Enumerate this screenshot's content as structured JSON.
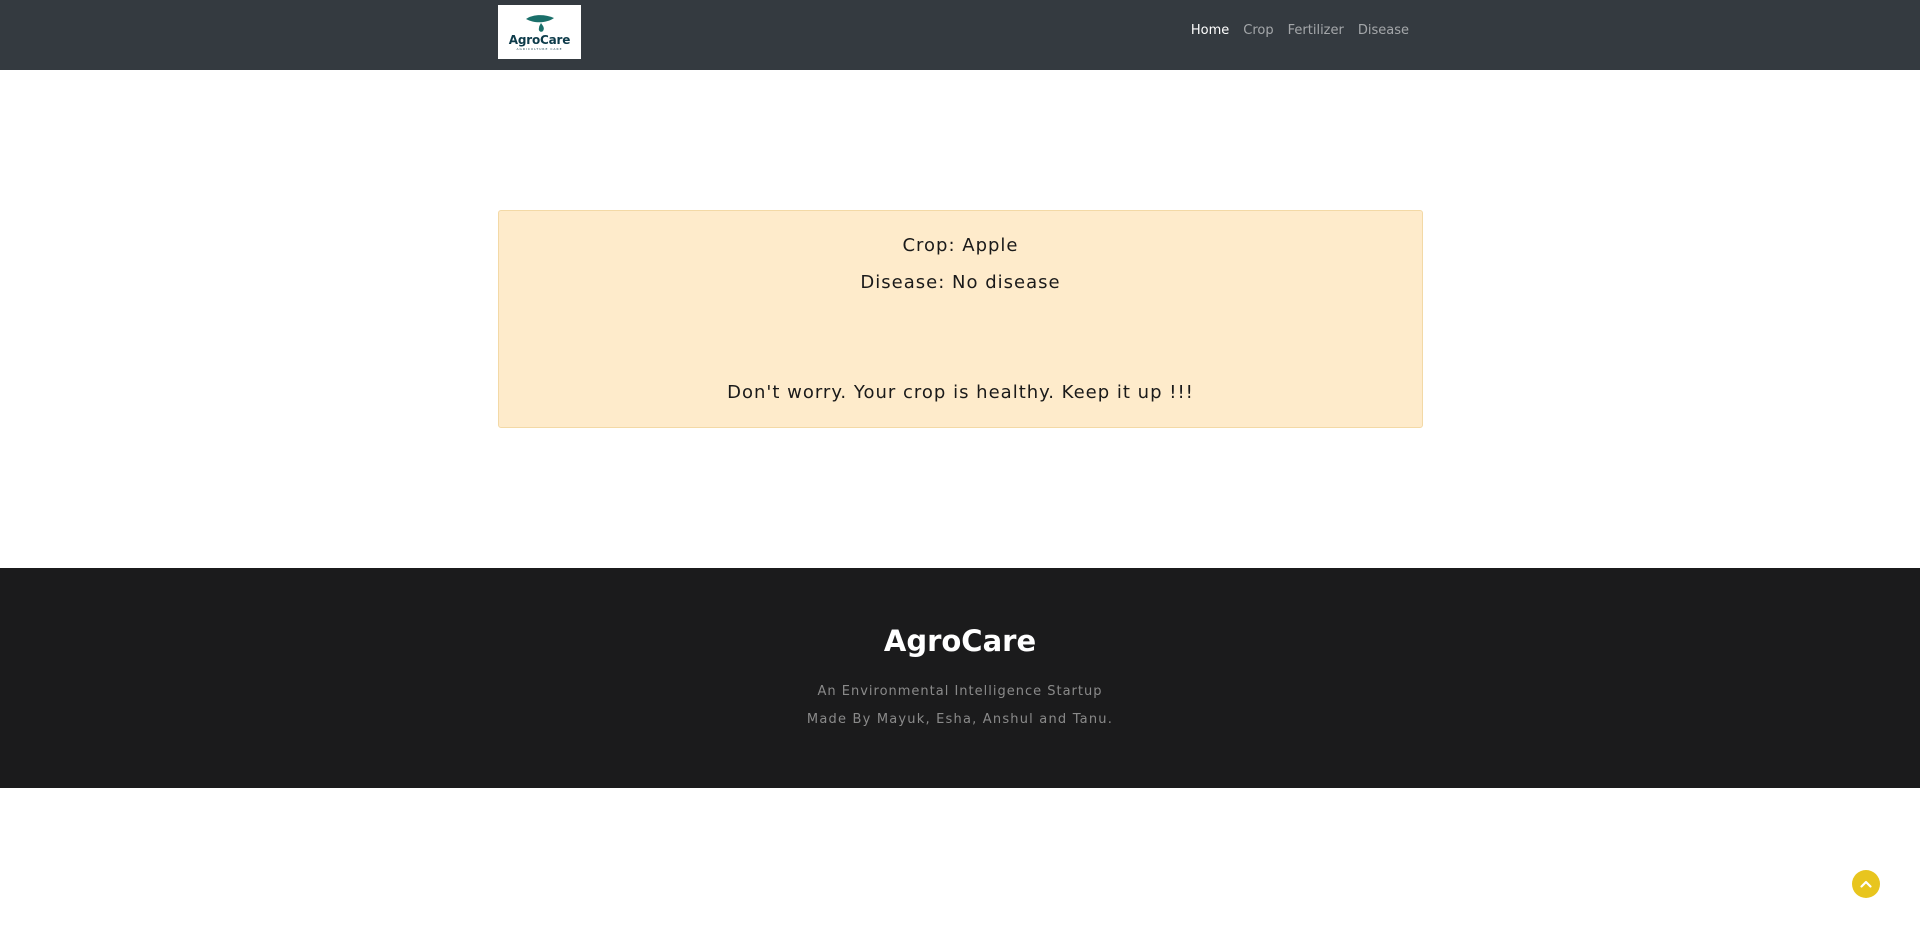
{
  "navbar": {
    "logo": {
      "text": "AgroCare",
      "subtext": "AGRICULTURE CARE"
    },
    "links": [
      {
        "label": "Home",
        "active": true
      },
      {
        "label": "Crop",
        "active": false
      },
      {
        "label": "Fertilizer",
        "active": false
      },
      {
        "label": "Disease",
        "active": false
      }
    ]
  },
  "result": {
    "crop": "Crop: Apple",
    "disease": "Disease: No disease",
    "message": "Don't worry. Your crop is healthy. Keep it up !!!"
  },
  "footer": {
    "title": "AgroCare",
    "tagline": "An Environmental Intelligence Startup",
    "credit": "Made By Mayuk, Esha, Anshul and Tanu."
  },
  "back_to_top": {
    "icon": "chevron-up-icon"
  },
  "colors": {
    "navbar_bg": "#343a40",
    "result_bg": "#feebcb",
    "footer_bg": "#1b1b1c",
    "accent": "#e8c51e",
    "logo_teal": "#1a6f6a"
  }
}
